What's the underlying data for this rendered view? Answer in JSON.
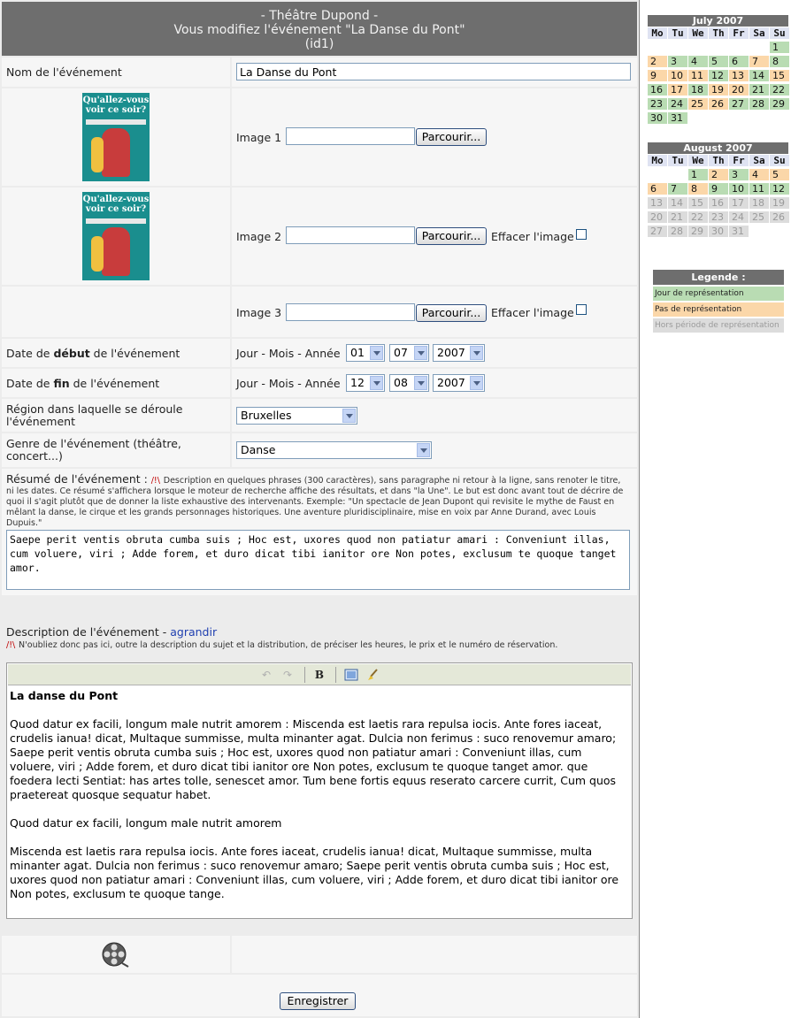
{
  "header": {
    "line1": "- Théâtre Dupond -",
    "line2": "Vous modifiez l'événement \"La Danse du Pont\"",
    "line3": "(id1)"
  },
  "form": {
    "name_label": "Nom de l'événement",
    "name_value": "La Danse du Pont",
    "poster_text": "Qu'allez-vous voir ce soir?",
    "image1_label": "Image 1",
    "image2_label": "Image 2",
    "image3_label": "Image 3",
    "browse_label": "Parcourir...",
    "delete_image_label": "Effacer l'image",
    "start_label_pre": "Date de ",
    "start_label_bold": "début",
    "start_label_post": " de l'événement",
    "end_label_pre": "Date de ",
    "end_label_bold": "fin",
    "end_label_post": " de l'événement",
    "date_format_label": "Jour - Mois - Année",
    "start_day": "01",
    "start_month": "07",
    "start_year": "2007",
    "end_day": "12",
    "end_month": "08",
    "end_year": "2007",
    "region_label": "Région dans laquelle se déroule l'événement",
    "region_value": "Bruxelles",
    "genre_label": "Genre de l'événement (théâtre, concert...)",
    "genre_value": "Danse",
    "summary_label": "Résumé de l'événement :",
    "warn_symbol": "/!\\",
    "summary_help": "Description en quelques phrases (300 caractères), sans paragraphe ni retour à la ligne, sans renoter le titre, ni les dates. Ce résumé s'affichera lorsque le moteur de recherche affiche des résultats, et dans \"la Une\". Le but est donc avant tout de décrire de quoi il s'agit plutôt que de donner la liste exhaustive des intervenants. Exemple: \"Un spectacle de Jean Dupont qui revisite le mythe de Faust en mêlant la danse, le cirque et les grands personnages historiques. Une aventure pluridisciplinaire, mise en voix par Anne Durand, avec Louis Dupuis.\"",
    "summary_value": "Saepe perit ventis obruta cumba suis ; Hoc est, uxores quod non patiatur amari : Conveniunt illas, cum voluere, viri ; Adde forem, et duro dicat tibi ianitor ore Non potes, exclusum te quoque tanget amor.",
    "description_label": "Description de l'événement - ",
    "enlarge_link": "agrandir",
    "description_help": "N'oubliez donc pas ici, outre la description du sujet et la distribution, de préciser les heures, le prix et le numéro de réservation.",
    "editor_bold_button": "B",
    "description_title": "La danse du Pont",
    "description_p1": "Quod datur ex facili, longum male nutrit amorem : Miscenda est laetis rara repulsa iocis. Ante fores iaceat, crudelis ianua! dicat, Multaque summisse, multa minanter agat. Dulcia non ferimus : suco renovemur amaro; Saepe perit ventis obruta cumba suis ; Hoc est, uxores quod non patiatur amari : Conveniunt illas, cum voluere, viri ; Adde forem, et duro dicat tibi ianitor ore Non potes, exclusum te quoque tanget amor. que foedera lecti Sentiat: has artes tolle, senescet amor. Tum bene fortis equus reserato carcere currit, Cum quos praetereat quosque sequatur habet.",
    "description_p2": "Quod datur ex facili, longum male nutrit amorem",
    "description_p3": "Miscenda est laetis rara repulsa iocis. Ante fores iaceat, crudelis ianua! dicat, Multaque summisse, multa minanter agat. Dulcia non ferimus : suco renovemur amaro; Saepe perit ventis obruta cumba suis ; Hoc est, uxores quod non patiatur amari : Conveniunt illas, cum voluere, viri ; Adde forem, et duro dicat tibi ianitor ore Non potes, exclusum te quoque tange.",
    "save_label": "Enregistrer"
  },
  "calendar": {
    "weekdays": [
      "Mo",
      "Tu",
      "We",
      "Th",
      "Fr",
      "Sa",
      "Su"
    ],
    "july": {
      "title": "July 2007",
      "days": [
        {
          "d": "",
          "t": "empty"
        },
        {
          "d": "",
          "t": "empty"
        },
        {
          "d": "",
          "t": "empty"
        },
        {
          "d": "",
          "t": "empty"
        },
        {
          "d": "",
          "t": "empty"
        },
        {
          "d": "",
          "t": "empty"
        },
        {
          "d": "1",
          "t": "rep"
        },
        {
          "d": "2",
          "t": "no"
        },
        {
          "d": "3",
          "t": "rep"
        },
        {
          "d": "4",
          "t": "rep"
        },
        {
          "d": "5",
          "t": "rep"
        },
        {
          "d": "6",
          "t": "rep"
        },
        {
          "d": "7",
          "t": "no"
        },
        {
          "d": "8",
          "t": "rep"
        },
        {
          "d": "9",
          "t": "no"
        },
        {
          "d": "10",
          "t": "no"
        },
        {
          "d": "11",
          "t": "no"
        },
        {
          "d": "12",
          "t": "rep"
        },
        {
          "d": "13",
          "t": "no"
        },
        {
          "d": "14",
          "t": "rep"
        },
        {
          "d": "15",
          "t": "no"
        },
        {
          "d": "16",
          "t": "rep"
        },
        {
          "d": "17",
          "t": "no"
        },
        {
          "d": "18",
          "t": "rep"
        },
        {
          "d": "19",
          "t": "no"
        },
        {
          "d": "20",
          "t": "no"
        },
        {
          "d": "21",
          "t": "rep"
        },
        {
          "d": "22",
          "t": "rep"
        },
        {
          "d": "23",
          "t": "rep"
        },
        {
          "d": "24",
          "t": "rep"
        },
        {
          "d": "25",
          "t": "no"
        },
        {
          "d": "26",
          "t": "no"
        },
        {
          "d": "27",
          "t": "rep"
        },
        {
          "d": "28",
          "t": "rep"
        },
        {
          "d": "29",
          "t": "rep"
        },
        {
          "d": "30",
          "t": "rep"
        },
        {
          "d": "31",
          "t": "rep"
        }
      ]
    },
    "august": {
      "title": "August 2007",
      "days": [
        {
          "d": "",
          "t": "empty"
        },
        {
          "d": "",
          "t": "empty"
        },
        {
          "d": "1",
          "t": "rep"
        },
        {
          "d": "2",
          "t": "no"
        },
        {
          "d": "3",
          "t": "rep"
        },
        {
          "d": "4",
          "t": "no"
        },
        {
          "d": "5",
          "t": "no"
        },
        {
          "d": "6",
          "t": "no"
        },
        {
          "d": "7",
          "t": "rep"
        },
        {
          "d": "8",
          "t": "no"
        },
        {
          "d": "9",
          "t": "rep"
        },
        {
          "d": "10",
          "t": "rep"
        },
        {
          "d": "11",
          "t": "rep"
        },
        {
          "d": "12",
          "t": "rep"
        },
        {
          "d": "13",
          "t": "out"
        },
        {
          "d": "14",
          "t": "out"
        },
        {
          "d": "15",
          "t": "out"
        },
        {
          "d": "16",
          "t": "out"
        },
        {
          "d": "17",
          "t": "out"
        },
        {
          "d": "18",
          "t": "out"
        },
        {
          "d": "19",
          "t": "out"
        },
        {
          "d": "20",
          "t": "out"
        },
        {
          "d": "21",
          "t": "out"
        },
        {
          "d": "22",
          "t": "out"
        },
        {
          "d": "23",
          "t": "out"
        },
        {
          "d": "24",
          "t": "out"
        },
        {
          "d": "25",
          "t": "out"
        },
        {
          "d": "26",
          "t": "out"
        },
        {
          "d": "27",
          "t": "out"
        },
        {
          "d": "28",
          "t": "out"
        },
        {
          "d": "29",
          "t": "out"
        },
        {
          "d": "30",
          "t": "out"
        },
        {
          "d": "31",
          "t": "out"
        }
      ]
    }
  },
  "legend": {
    "title": "Legende :",
    "rep": "Jour de représentation",
    "no": "Pas de représentation",
    "out": "Hors période de représentation"
  },
  "colors": {
    "header_bg": "#6e6e6e",
    "representation": "#b9dcb3",
    "no_representation": "#fbd7a9",
    "out_of_period": "#dcdcdc"
  },
  "icons": [
    "undo-icon",
    "redo-icon",
    "bold-icon",
    "image-icon",
    "clean-icon",
    "film-reel-icon"
  ]
}
